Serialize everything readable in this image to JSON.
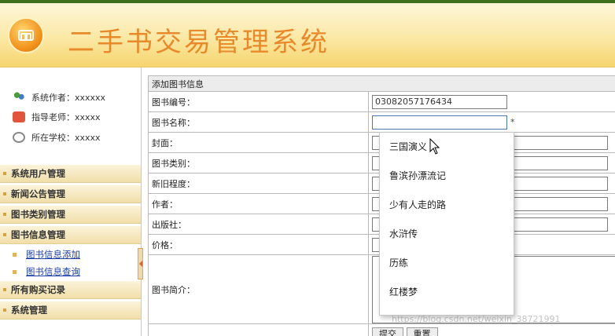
{
  "header": {
    "title": "二手书交易管理系统"
  },
  "sidebar": {
    "info": [
      {
        "icon": "users-icon",
        "text": "系统作者：xxxxxx"
      },
      {
        "icon": "teacher-icon",
        "text": "指导老师：xxxxx"
      },
      {
        "icon": "school-icon",
        "text": "所在学校：xxxxx"
      }
    ],
    "menu": [
      {
        "label": "系统用户管理"
      },
      {
        "label": "新闻公告管理"
      },
      {
        "label": "图书类别管理"
      },
      {
        "label": "图书信息管理"
      }
    ],
    "sub_items": [
      {
        "label": "图书信息添加"
      },
      {
        "label": "图书信息查询"
      }
    ],
    "menu_after": [
      {
        "label": "所有购买记录"
      },
      {
        "label": "系统管理"
      }
    ]
  },
  "form": {
    "section_title": "添加图书信息",
    "fields": {
      "book_no": {
        "label": "图书编号：",
        "value": "03082057176434"
      },
      "book_name": {
        "label": "图书名称：",
        "value": "",
        "required": "*"
      },
      "cover": {
        "label": "封面："
      },
      "category": {
        "label": "图书类别："
      },
      "condition": {
        "label": "新旧程度："
      },
      "author": {
        "label": "作者："
      },
      "publisher": {
        "label": "出版社："
      },
      "price": {
        "label": "价格：",
        "required": "*"
      },
      "intro": {
        "label": "图书简介："
      }
    },
    "buttons": {
      "submit": "提交",
      "reset": "重置"
    }
  },
  "autocomplete": {
    "options": [
      "三国演义",
      "鲁滨孙漂流记",
      "少有人走的路",
      "水浒传",
      "历练",
      "红楼梦"
    ]
  },
  "watermark": "https://blog.csdn.net/weixin_38721991",
  "colors": {
    "title": "#e8892a",
    "link": "#1c3faa",
    "header_bg": "#fbe9a8"
  }
}
